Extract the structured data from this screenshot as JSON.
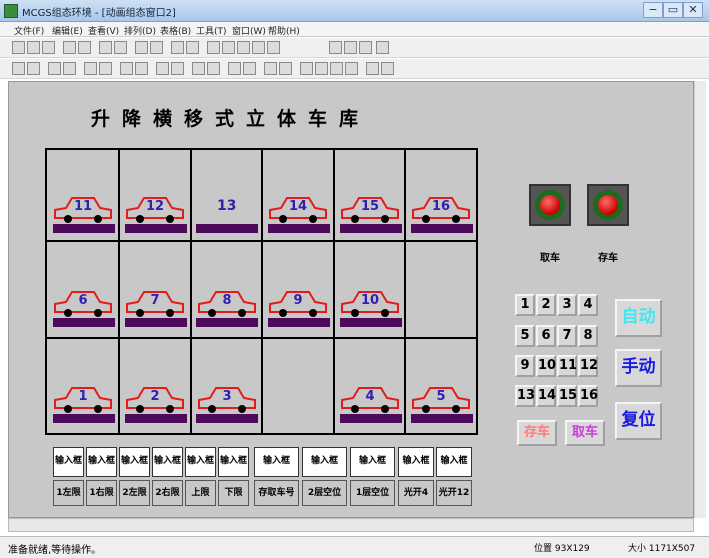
{
  "window": {
    "title": "MCGS组态环境 - [动画组态窗口2]",
    "minimize": "−",
    "restore": "▭",
    "close": "✕"
  },
  "menu": [
    "文件(F)",
    "编辑(E)",
    "查看(V)",
    "排列(D)",
    "表格(B)",
    "工具(T)",
    "窗口(W)",
    "帮助(H)"
  ],
  "canvas": {
    "title": "升降横移式立体车库",
    "slots_row1": [
      "11",
      "12",
      "13",
      "14",
      "15",
      "16"
    ],
    "slots_row2": [
      "6",
      "7",
      "8",
      "9",
      "10"
    ],
    "slots_row3": [
      "1",
      "2",
      "3",
      "4",
      "5"
    ],
    "empty_slot_label": "13",
    "lights": {
      "retrieve_label": "取车",
      "store_label": "存车"
    },
    "keypad": [
      "1",
      "2",
      "3",
      "4",
      "5",
      "6",
      "7",
      "8",
      "9",
      "10",
      "11",
      "12",
      "13",
      "14",
      "15",
      "16"
    ],
    "auto_label": "自动",
    "manual_label": "手动",
    "reset_label": "复位",
    "store_btn": "存车",
    "retrieve_btn": "取车",
    "inputs": [
      "输入框",
      "输入框",
      "输入框",
      "输入框",
      "输入框",
      "输入框",
      "输入框",
      "输入框",
      "输入框",
      "输入框",
      "输入框"
    ],
    "labels": [
      "1左限",
      "1右限",
      "2左限",
      "2右限",
      "上限",
      "下限",
      "存取车号",
      "2层空位",
      "1层空位",
      "光开4",
      "光开12"
    ]
  },
  "colors": {
    "pallet": "#4d0a5a",
    "car": "#e21b1b",
    "auto": "#3ee8f0",
    "manual": "#1a1ae0",
    "reset": "#1a1ae0",
    "store": "#ff7a7a",
    "retrieve": "#c83cd8"
  },
  "status": {
    "message": "准备就绪,等待操作。",
    "position": "位置 93X129",
    "size": "大小 1171X507"
  }
}
